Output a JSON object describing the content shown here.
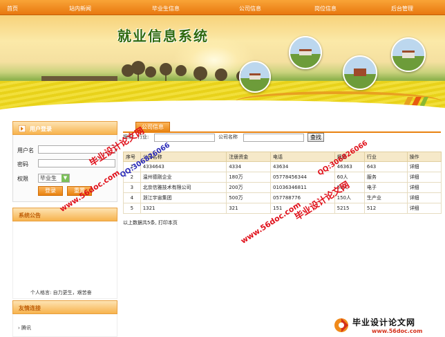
{
  "nav": {
    "items": [
      "首页",
      "站内新闻",
      "毕业生信息",
      "公司信息",
      "岗位信息",
      "后台管理"
    ]
  },
  "banner": {
    "title": "就业信息系统"
  },
  "login": {
    "header": "用户登录",
    "username_label": "用户名",
    "password_label": "密码",
    "role_label": "权限",
    "role_value": "毕业生",
    "login_button": "登录",
    "reset_button": "重置"
  },
  "notice": {
    "header": "系统公告",
    "motto": "个人格言: 自力更生，艰苦奋"
  },
  "links": {
    "header": "友情连接",
    "items": [
      "腾讯"
    ]
  },
  "main": {
    "tab_label": "公司信息",
    "search": {
      "label": "搜索：行业:",
      "company_label": "公司名称",
      "button": "查找"
    },
    "table": {
      "headers": [
        "序号",
        "公司名称",
        "注册资金",
        "电话",
        "规模",
        "行业",
        "操作"
      ],
      "rows": [
        [
          "1",
          "4334643",
          "4334",
          "43634",
          "46363",
          "643",
          "详细"
        ],
        [
          "2",
          "温州德刚企业",
          "180万",
          "05778456344",
          "60人",
          "服务",
          "详细"
        ],
        [
          "3",
          "北京信雅技术有限公司",
          "200万",
          "01036346811",
          "50人",
          "电子",
          "详细"
        ],
        [
          "4",
          "浙江宇宙集团",
          "500万",
          "057788776",
          "150人",
          "生产业",
          "详细"
        ],
        [
          "5",
          "1321",
          "321",
          "151",
          "5215",
          "512",
          "详细"
        ]
      ]
    },
    "footer": "以上数据共5条, 打印本页"
  },
  "watermarks": {
    "red_text": "毕业设计论文网",
    "url_text": "www.56doc.com",
    "qq_text": "QQ:306826066",
    "brand_title": "毕业设计论文网",
    "brand_url": "www.56doc.com"
  },
  "colors": {
    "nav_orange": "#e8780f",
    "accent": "#f7b34d",
    "table_header": "#f6e9c9"
  }
}
